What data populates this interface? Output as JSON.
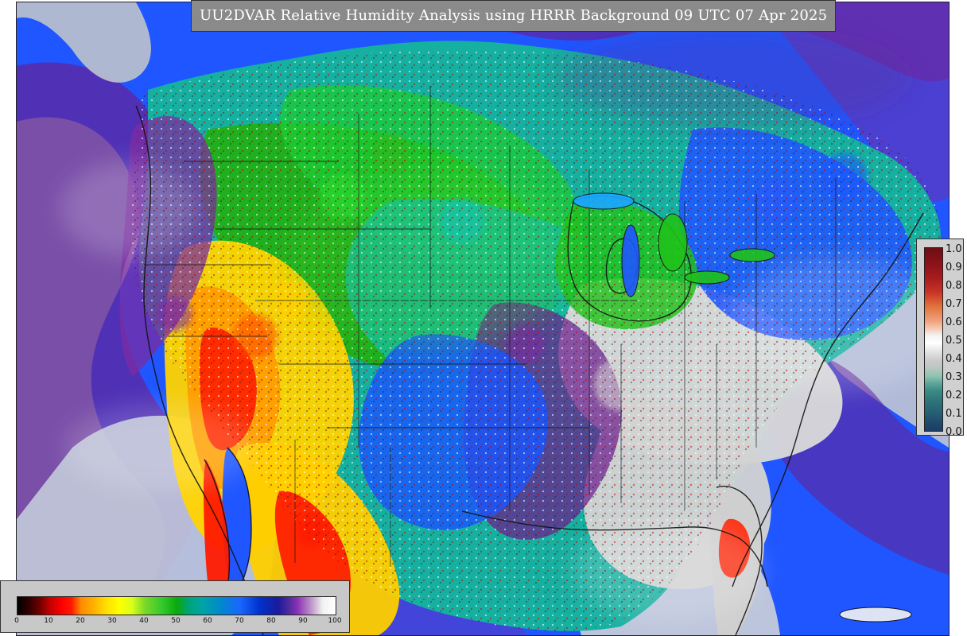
{
  "title": "UU2DVAR Relative Humidity Analysis using HRRR Background 09 UTC 07 Apr 2025",
  "colors": {
    "map_background": "#d8d8d8",
    "ocean_blue": "#1f56ff",
    "deep_purple": "#6b1e8f",
    "light_purple": "#c36ad6",
    "gray": "#bdbdbd",
    "land_green": "#26b50a",
    "land_green_light": "#56d52b",
    "teal": "#0aa7a0",
    "aqua": "#18c4b4",
    "desert_yellow": "#ffd400",
    "desert_orange": "#ff8c00",
    "desert_red": "#ff2a00",
    "dark_blue": "#1a2bc8",
    "outline": "#111111"
  },
  "legend_right": {
    "ticks": [
      "1.0",
      "0.9",
      "0.8",
      "0.7",
      "0.6",
      "0.5",
      "0.4",
      "0.3",
      "0.2",
      "0.1",
      "0.0"
    ]
  },
  "legend_bottom": {
    "ticks": [
      "0",
      "10",
      "20",
      "30",
      "40",
      "50",
      "60",
      "70",
      "80",
      "90",
      "100"
    ]
  },
  "map": {
    "alt": ""
  }
}
